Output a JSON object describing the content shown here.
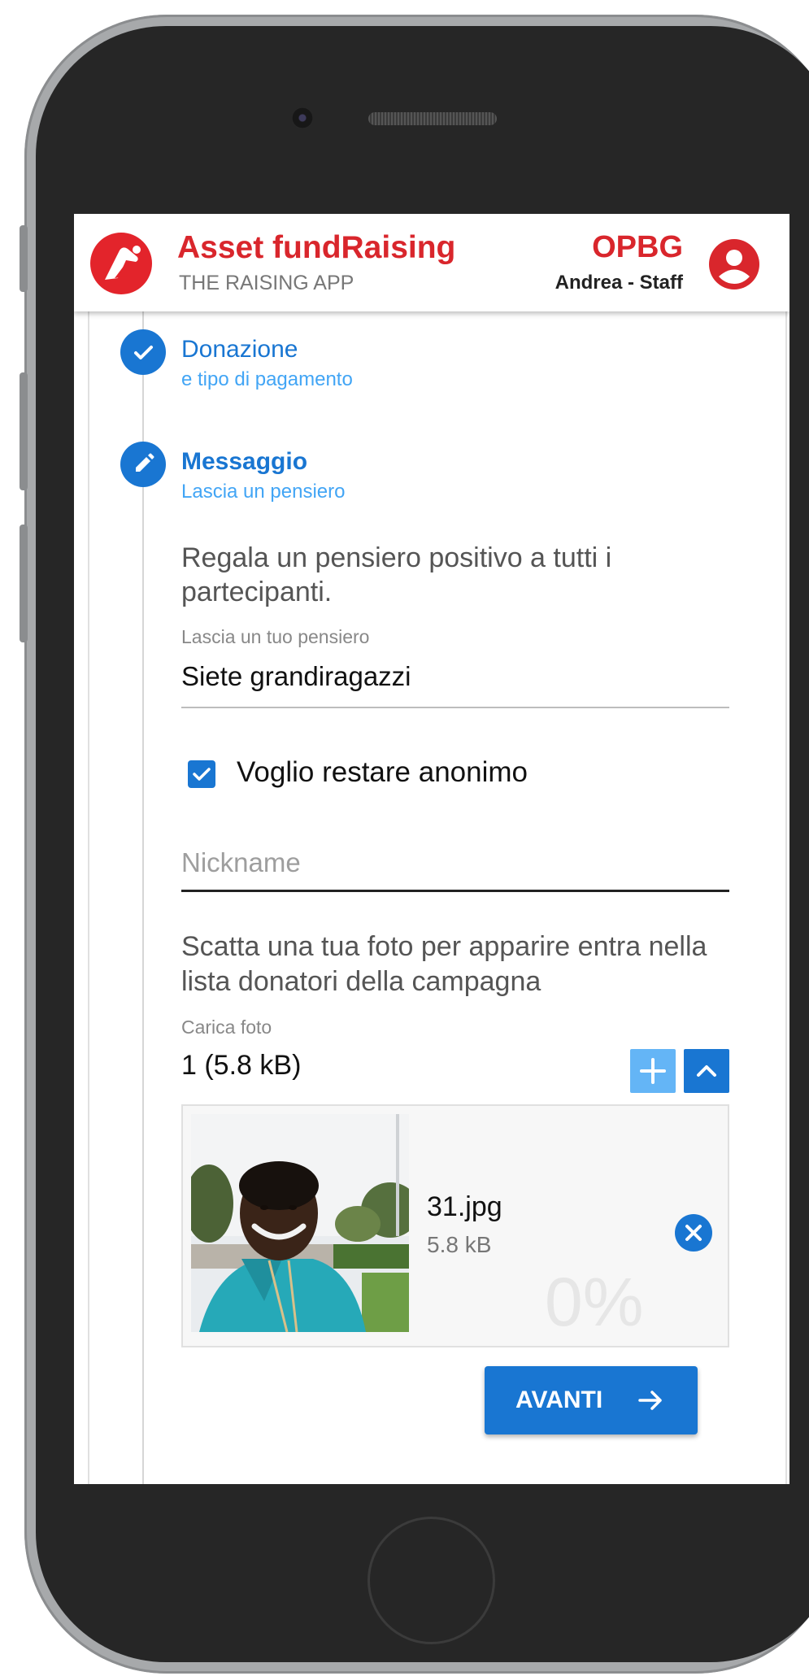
{
  "header": {
    "app_title": "Asset fundRaising",
    "app_subtitle": "THE RAISING APP",
    "org_code": "OPBG",
    "user_name": "Andrea - Staff"
  },
  "steps": [
    {
      "title": "Donazione",
      "subtitle": "e tipo di pagamento",
      "status": "completed",
      "icon": "check-icon"
    },
    {
      "title": "Messaggio",
      "subtitle": "Lascia un pensiero",
      "status": "editing",
      "icon": "pencil-icon"
    }
  ],
  "message_step": {
    "intro": "Regala un pensiero positivo a tutti i partecipanti.",
    "message_label": "Lascia un tuo pensiero",
    "message_value": "Siete grandiragazzi",
    "anonymous_label": "Voglio restare anonimo",
    "anonymous_checked": true,
    "nickname_placeholder": "Nickname",
    "nickname_value": "",
    "photo_intro": "Scatta una tua foto per apparire entra nella lista donatori della campagna",
    "upload_label": "Carica foto",
    "upload_count": "1 (5.8 kB)",
    "file": {
      "name": "31.jpg",
      "size": "5.8 kB",
      "progress_text": "0%"
    },
    "next_label": "AVANTI"
  },
  "colors": {
    "brand_red": "#d9262c",
    "primary_blue": "#1976d2",
    "light_blue": "#42a5f5"
  }
}
